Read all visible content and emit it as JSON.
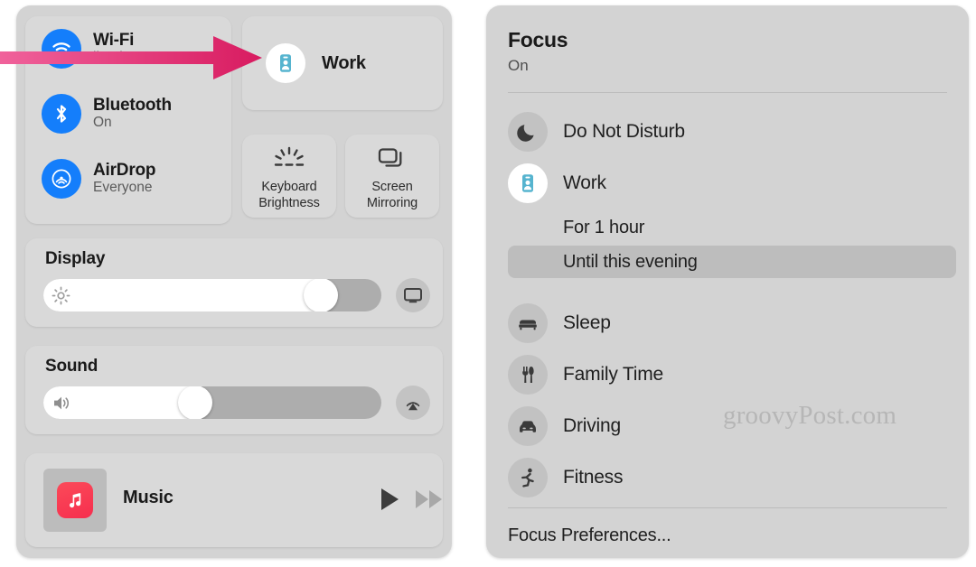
{
  "control_center": {
    "connectivity": [
      {
        "icon": "wifi-icon",
        "title": "Wi-Fi",
        "subtitle": "lion-luma"
      },
      {
        "icon": "bluetooth-icon",
        "title": "Bluetooth",
        "subtitle": "On"
      },
      {
        "icon": "airdrop-icon",
        "title": "AirDrop",
        "subtitle": "Everyone"
      }
    ],
    "focus_tile": {
      "icon": "work-badge-icon",
      "label": "Work"
    },
    "small_tiles": [
      {
        "icon": "keyboard-brightness-icon",
        "line1": "Keyboard",
        "line2": "Brightness"
      },
      {
        "icon": "screen-mirroring-icon",
        "line1": "Screen",
        "line2": "Mirroring"
      }
    ],
    "display": {
      "heading": "Display",
      "value_percent": 82,
      "slider_icon": "brightness-sun-icon",
      "side_button_icon": "display-monitor-icon"
    },
    "sound": {
      "heading": "Sound",
      "value_percent": 45,
      "slider_icon": "speaker-volume-icon",
      "side_button_icon": "airplay-audio-icon"
    },
    "music": {
      "label": "Music",
      "app_icon": "apple-music-icon",
      "play_icon": "play-icon",
      "next_icon": "fast-forward-icon"
    }
  },
  "focus_panel": {
    "title": "Focus",
    "state": "On",
    "modes": [
      {
        "icon": "moon-icon",
        "label": "Do Not Disturb"
      },
      {
        "icon": "work-badge-icon",
        "label": "Work"
      },
      {
        "icon": "bed-icon",
        "label": "Sleep"
      },
      {
        "icon": "fork-knife-icon",
        "label": "Family Time"
      },
      {
        "icon": "car-icon",
        "label": "Driving"
      },
      {
        "icon": "running-icon",
        "label": "Fitness"
      }
    ],
    "work_duration_options": [
      {
        "label": "For 1 hour",
        "selected": false
      },
      {
        "label": "Until this evening",
        "selected": true
      }
    ],
    "preferences_label": "Focus Preferences..."
  },
  "annotation": {
    "arrow": "pink-arrow-pointing-right",
    "color_start": "#f0629b",
    "color_end": "#d81b60"
  },
  "watermark": {
    "text": "groovyPost.com"
  },
  "colors": {
    "panel": "#d3d3d3",
    "tile": "#d9d9d9",
    "accent_blue": "#147efb",
    "work_teal": "#56b4cf",
    "music_red": "#f62e4e",
    "selected_row": "#bdbdbd"
  }
}
